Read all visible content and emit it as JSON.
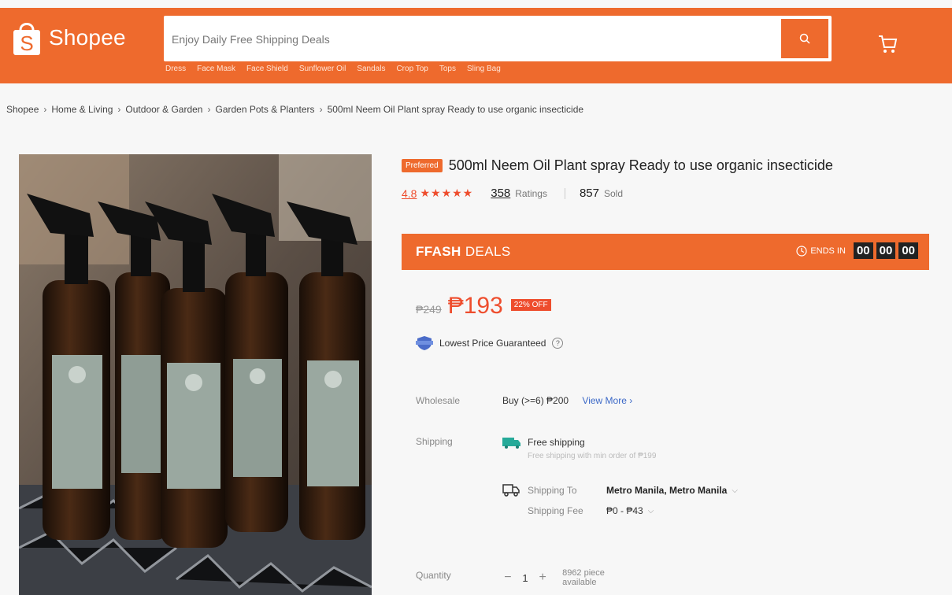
{
  "header": {
    "logo_text": "Shopee",
    "logo_letter": "S",
    "search_placeholder": "Enjoy Daily Free Shipping Deals",
    "quick_links": [
      "Dress",
      "Face Mask",
      "Face Shield",
      "Sunflower Oil",
      "Sandals",
      "Crop Top",
      "Tops",
      "Sling Bag"
    ]
  },
  "breadcrumb": [
    "Shopee",
    "Home & Living",
    "Outdoor & Garden",
    "Garden Pots & Planters",
    "500ml Neem Oil Plant spray Ready to use organic insecticide"
  ],
  "product": {
    "badge": "Preferred",
    "title": "500ml Neem Oil Plant spray Ready to use organic insecticide",
    "rating": "4.8",
    "stars": "★★★★★",
    "ratings_count": "358",
    "ratings_label": "Ratings",
    "sold_count": "857",
    "sold_label": "Sold"
  },
  "flash": {
    "title_a": "FFASH",
    "title_b": " DEALS",
    "ends_label": "ENDS IN",
    "h": "00",
    "m": "00",
    "s": "00"
  },
  "price": {
    "old": "₱249",
    "new": "₱193",
    "off": "22% OFF"
  },
  "guarantee": {
    "text": "Lowest Price Guaranteed",
    "help": "?"
  },
  "wholesale": {
    "label": "Wholesale",
    "value": "Buy (>=6) ₱200",
    "view_more": "View More ›"
  },
  "shipping": {
    "label": "Shipping",
    "free_text": "Free shipping",
    "free_sub": "Free shipping with min order of ₱199",
    "to_label": "Shipping To",
    "to_value": "Metro Manila, Metro Manila",
    "fee_label": "Shipping Fee",
    "fee_value": "₱0 - ₱43"
  },
  "quantity": {
    "label": "Quantity",
    "minus": "−",
    "value": "1",
    "plus": "+",
    "available": "8962 piece available"
  },
  "colors": {
    "brand": "#ee6a2d",
    "price": "#ee4d2d",
    "link": "#3b68c7"
  },
  "icons": {
    "search": "search-icon",
    "cart": "cart-icon",
    "clock": "clock-icon",
    "truck": "truck-icon",
    "free_ship": "free-shipping-icon",
    "shield": "shield-icon"
  }
}
